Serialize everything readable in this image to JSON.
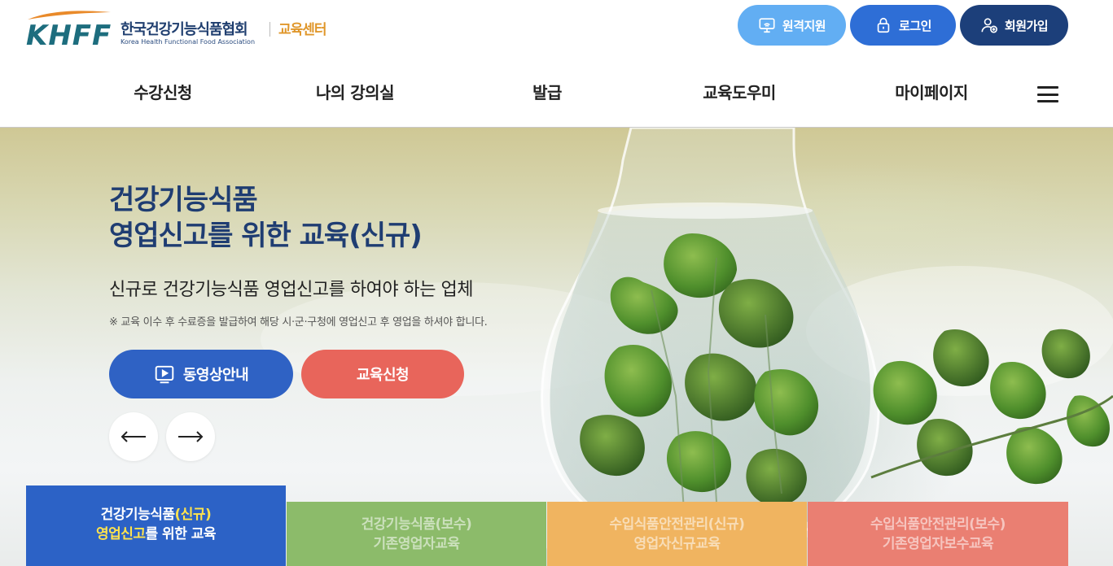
{
  "brand": {
    "logo_letters": "KHFF",
    "name_ko": "한국건강기능식품협회",
    "name_en": "Korea Health Functional Food Association",
    "center": "교육센터"
  },
  "top_buttons": {
    "remote": "원격지원",
    "login": "로그인",
    "join": "회원가입"
  },
  "nav": {
    "items": [
      "수강신청",
      "나의 강의실",
      "발급",
      "교육도우미",
      "마이페이지"
    ]
  },
  "hero": {
    "title_line1": "건강기능식품",
    "title_line2": "영업신고를 위한 교육(신규)",
    "subtitle": "신규로 건강기능식품 영업신고를 하여야 하는 업체",
    "note": "※ 교육 이수 후 수료증을 발급하여 해당 시·군·구청에 영업신고 후 영업을 하셔야 합니다.",
    "video_button": "동영상안내",
    "apply_button": "교육신청"
  },
  "tabs": [
    {
      "line1_a": "건강기능식품",
      "line1_b": "(신규)",
      "line2_a": "영업신고",
      "line2_b": "를 위한 교육",
      "active": true
    },
    {
      "line1": "건강기능식품(보수)",
      "line2": "기존영업자교육",
      "active": false
    },
    {
      "line1": "수입식품안전관리(신규)",
      "line2": "영업자신규교육",
      "active": false
    },
    {
      "line1": "수입식품안전관리(보수)",
      "line2": "기존영업자보수교육",
      "active": false
    }
  ],
  "colors": {
    "brand_navy": "#1f3d72",
    "remote_btn": "#62aef3",
    "login_btn": "#2e6ed6",
    "join_btn": "#1c3f7a",
    "video_btn": "#2f62c4",
    "apply_btn": "#e8655b",
    "tab_active": "#2c62c6",
    "tab_green": "#8cbb6a",
    "tab_orange": "#f0b460",
    "tab_red": "#ea7f72",
    "highlight_yellow": "#ffe34d"
  }
}
